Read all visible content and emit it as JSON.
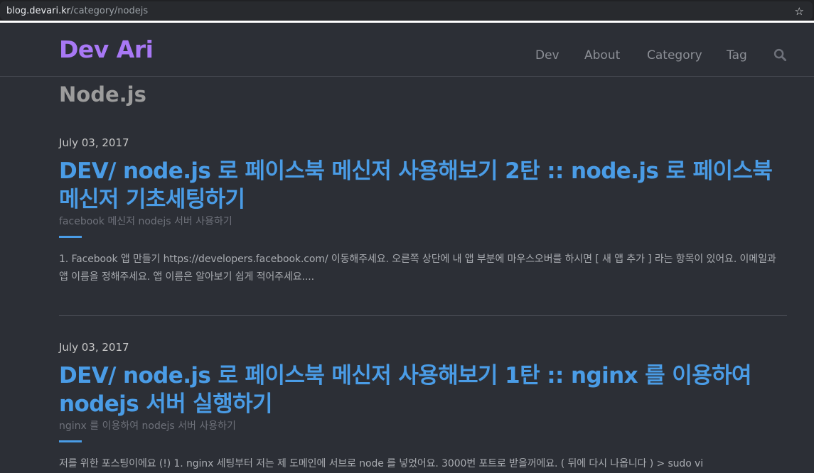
{
  "browser": {
    "url_domain": "blog.devari.kr",
    "url_path": "/category/nodejs",
    "bookmark_icon": "star-icon"
  },
  "navbar": {
    "brand": "Dev Ari",
    "items": [
      {
        "label": "Dev"
      },
      {
        "label": "About"
      },
      {
        "label": "Category"
      },
      {
        "label": "Tag"
      }
    ],
    "search_icon": "search-icon"
  },
  "page": {
    "category_title": "Node.js"
  },
  "posts": [
    {
      "date": "July 03, 2017",
      "title": "DEV/ node.js 로 페이스북 메신저 사용해보기 2탄 :: node.js 로 페이스북 메신저 기초세팅하기",
      "subtitle": "facebook 메신저 nodejs 서버 사용하기",
      "excerpt": "1. Facebook 앱 만들기 https://developers.facebook.com/ 이동해주세요. 오른쪽 상단에 내 앱 부분에 마우스오버를 하시면 [ 새 앱 추가 ] 라는 항목이 있어요. 이메일과 앱 이름을 정해주세요. 앱 이름은 알아보기 쉽게 적어주세요...."
    },
    {
      "date": "July 03, 2017",
      "title": "DEV/ node.js 로 페이스북 메신저 사용해보기 1탄 :: nginx 를 이용하여 nodejs 서버 실행하기",
      "subtitle": "nginx 를 이용하여 nodejs 서버 사용하기",
      "excerpt": "저를 위한 포스팅이에요 (!) 1. nginx 세팅부터 저는 제 도메인에 서브로 node 를 넣었어요. 3000번 포트로 받을꺼에요. ( 뒤에 다시 나옵니다 ) > sudo vi"
    }
  ],
  "colors": {
    "background": "#2c2f36",
    "brand": "#a878f5",
    "link": "#4a9ce6",
    "nav_text": "#8c8f96"
  }
}
